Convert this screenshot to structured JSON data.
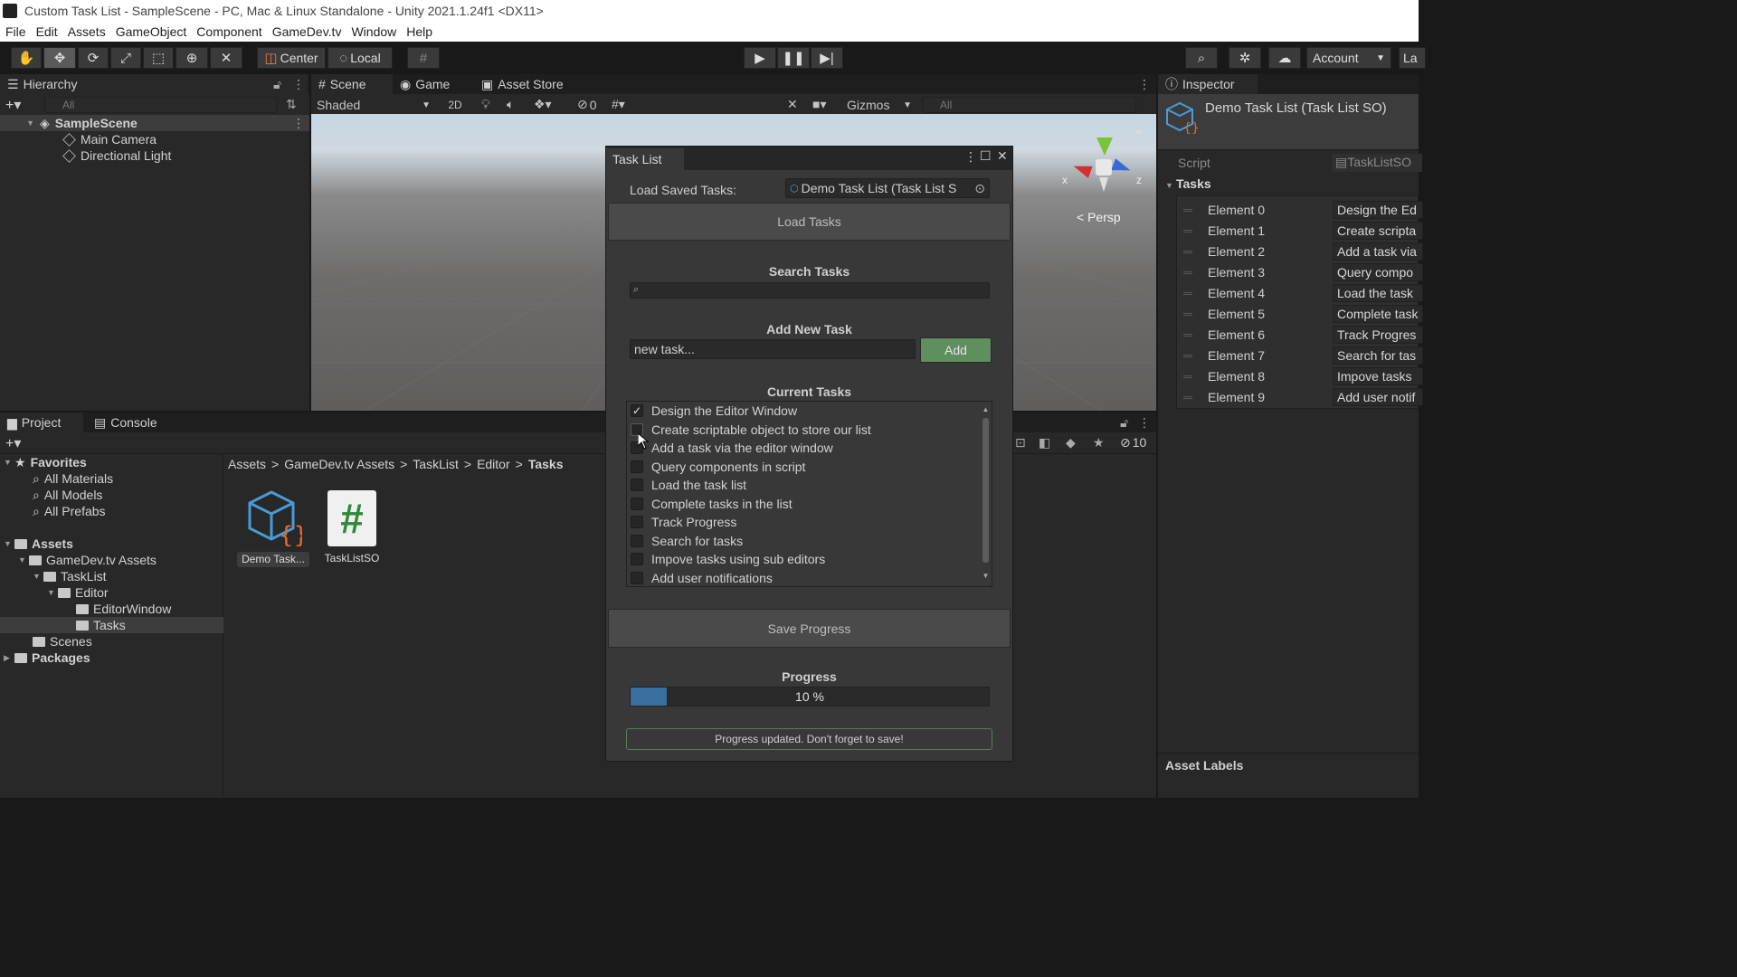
{
  "window_title": "Custom Task List - SampleScene - PC, Mac & Linux Standalone - Unity 2021.1.24f1 <DX11>",
  "menu": [
    "File",
    "Edit",
    "Assets",
    "GameObject",
    "Component",
    "GameDev.tv",
    "Window",
    "Help"
  ],
  "toolbar": {
    "center_label": "Center",
    "local_label": "Local",
    "account_label": "Account",
    "layers_label": "La"
  },
  "hierarchy": {
    "tab": "Hierarchy",
    "search_placeholder": "All",
    "scene": "SampleScene",
    "items": [
      "Main Camera",
      "Directional Light"
    ]
  },
  "scene_view": {
    "tabs": [
      "Scene",
      "Game",
      "Asset Store"
    ],
    "shading": "Shaded",
    "mode_2d": "2D",
    "hidden_count": "0",
    "gizmos": "Gizmos",
    "search_placeholder": "All",
    "persp_label": "Persp",
    "axis_x": "x",
    "axis_z": "z"
  },
  "project": {
    "tabs": [
      "Project",
      "Console"
    ],
    "favorites": "Favorites",
    "favorite_items": [
      "All Materials",
      "All Models",
      "All Prefabs"
    ],
    "assets": "Assets",
    "tree": [
      "GameDev.tv Assets",
      "TaskList",
      "Editor",
      "EditorWindow",
      "Tasks",
      "Scenes"
    ],
    "packages": "Packages",
    "breadcrumb": [
      "Assets",
      "GameDev.tv Assets",
      "TaskList",
      "Editor",
      "Tasks"
    ],
    "files": [
      {
        "name": "Demo Task...",
        "icon": "scriptable-object-icon"
      },
      {
        "name": "TaskListSO",
        "icon": "csharp-script-icon"
      }
    ],
    "hidden_count": "10"
  },
  "task_window": {
    "tab": "Task List",
    "load_label": "Load Saved Tasks:",
    "load_value": "Demo Task List (Task List S",
    "load_button": "Load Tasks",
    "search_heading": "Search Tasks",
    "search_value": "",
    "add_heading": "Add New Task",
    "new_task_value": "new task...",
    "add_button": "Add",
    "current_heading": "Current Tasks",
    "tasks": [
      {
        "label": "Design the Editor Window",
        "checked": true
      },
      {
        "label": "Create scriptable object to store our list",
        "checked": false
      },
      {
        "label": "Add a task via the editor window",
        "checked": false
      },
      {
        "label": "Query components in script",
        "checked": false
      },
      {
        "label": "Load the task list",
        "checked": false
      },
      {
        "label": "Complete tasks in the list",
        "checked": false
      },
      {
        "label": "Track Progress",
        "checked": false
      },
      {
        "label": "Search for tasks",
        "checked": false
      },
      {
        "label": "Impove tasks using sub editors",
        "checked": false
      },
      {
        "label": "Add user notifications",
        "checked": false
      }
    ],
    "save_button": "Save Progress",
    "progress_heading": "Progress",
    "progress_value": 0.1,
    "progress_text": "10 %",
    "notification": "Progress updated. Don't forget to save!"
  },
  "inspector": {
    "tab": "Inspector",
    "title": "Demo Task List (Task List SO)",
    "script_label": "Script",
    "script_value": "TaskListSO",
    "tasks_label": "Tasks",
    "elements": [
      {
        "label": "Element 0",
        "value": "Design the Ed"
      },
      {
        "label": "Element 1",
        "value": "Create scripta"
      },
      {
        "label": "Element 2",
        "value": "Add a task via"
      },
      {
        "label": "Element 3",
        "value": "Query compo"
      },
      {
        "label": "Element 4",
        "value": "Load the task"
      },
      {
        "label": "Element 5",
        "value": "Complete task"
      },
      {
        "label": "Element 6",
        "value": "Track Progres"
      },
      {
        "label": "Element 7",
        "value": "Search for tas"
      },
      {
        "label": "Element 8",
        "value": "Impove tasks"
      },
      {
        "label": "Element 9",
        "value": "Add user notif"
      }
    ],
    "asset_labels": "Asset Labels"
  },
  "colors": {
    "accent_blue": "#3a6e9e",
    "add_green": "#5f8f5f",
    "panel": "#282828",
    "window": "#383838"
  }
}
